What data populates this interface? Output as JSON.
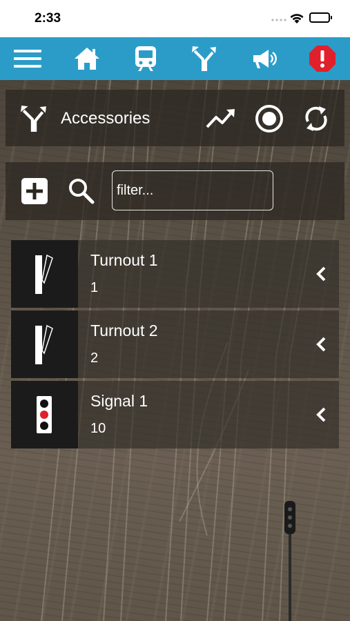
{
  "status_bar": {
    "time": "2:33"
  },
  "nav": {
    "icons": [
      "menu-icon",
      "home-icon",
      "train-icon",
      "turnout-icon",
      "megaphone-icon",
      "alert-icon"
    ],
    "accent_color": "#2b9cc8",
    "alert_color": "#e0202a"
  },
  "header": {
    "title": "Accessories"
  },
  "filter": {
    "placeholder": "filter...",
    "value": ""
  },
  "accessories": [
    {
      "name": "Turnout 1",
      "address": "1",
      "type": "turnout"
    },
    {
      "name": "Turnout 2",
      "address": "2",
      "type": "turnout"
    },
    {
      "name": "Signal 1",
      "address": "10",
      "type": "signal"
    }
  ]
}
